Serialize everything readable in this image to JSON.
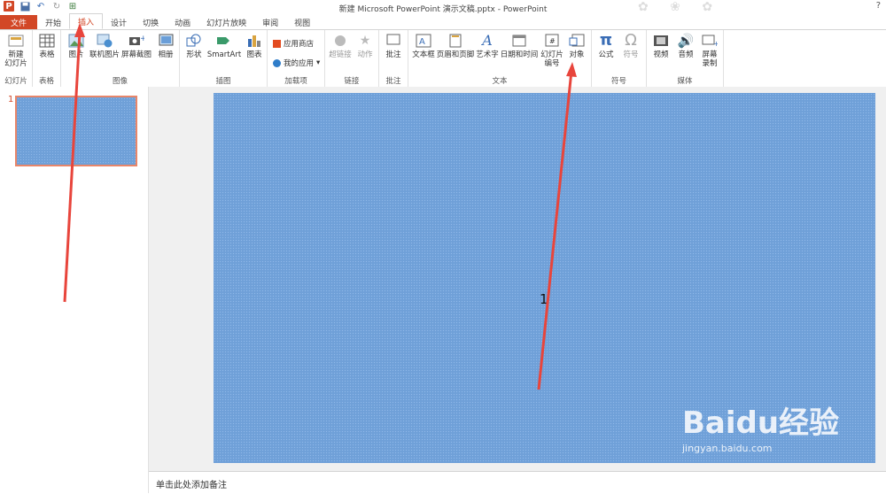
{
  "window": {
    "title": "新建 Microsoft PowerPoint 演示文稿.pptx - PowerPoint",
    "help": "?",
    "qat_icons": [
      "powerpoint-logo",
      "save-icon",
      "undo-icon",
      "redo-icon",
      "slideshow-icon"
    ]
  },
  "tabs": [
    "文件",
    "开始",
    "插入",
    "设计",
    "切换",
    "动画",
    "幻灯片放映",
    "审阅",
    "视图"
  ],
  "ribbon": {
    "slides": {
      "label": "幻灯片",
      "new_slide": "新建\n幻灯片"
    },
    "tables": {
      "label": "表格",
      "table": "表格"
    },
    "images": {
      "label": "图像",
      "picture": "图片",
      "online_picture": "联机图片",
      "screenshot": "屏幕截图",
      "album": "相册"
    },
    "illustrations": {
      "label": "插图",
      "shapes": "形状",
      "smartart": "SmartArt",
      "chart": "图表"
    },
    "addins": {
      "label": "加载项",
      "store": "应用商店",
      "my_apps": "我的应用"
    },
    "links": {
      "label": "链接",
      "hyperlink": "超链接",
      "action": "动作"
    },
    "comments": {
      "label": "批注",
      "comment": "批注"
    },
    "text": {
      "label": "文本",
      "textbox": "文本框",
      "header_footer": "页眉和页脚",
      "wordart": "艺术字",
      "datetime": "日期和时间",
      "slide_number": "幻灯片\n编号",
      "object": "对象"
    },
    "symbols": {
      "label": "符号",
      "equation": "公式",
      "symbol": "符号"
    },
    "media": {
      "label": "媒体",
      "video": "视频",
      "audio": "音频",
      "screen_recording": "屏幕\n录制"
    }
  },
  "thumbnails": {
    "slide_number": "1"
  },
  "slide": {
    "annotation_number": "1"
  },
  "notes": {
    "placeholder": "单击此处添加备注"
  },
  "watermark": {
    "logo": "Baidu经验",
    "url": "jingyan.baidu.com"
  },
  "colors": {
    "accent": "#d24726",
    "slide_bg": "#6fa0d8",
    "arrow": "#e8453c"
  }
}
